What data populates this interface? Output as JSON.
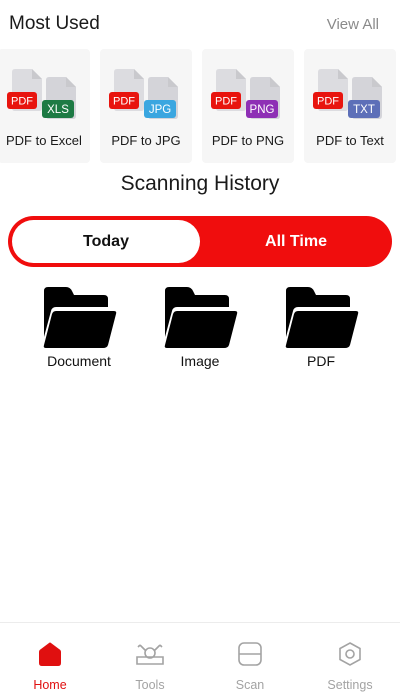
{
  "most_used": {
    "title": "Most Used",
    "view_all": "View All",
    "tools": [
      {
        "label": "PDF to Excel",
        "src_badge": "PDF",
        "dst_badge": "XLS",
        "dst_color": "#1d7a44"
      },
      {
        "label": "PDF to JPG",
        "src_badge": "PDF",
        "dst_badge": "JPG",
        "dst_color": "#3aa6e0"
      },
      {
        "label": "PDF to PNG",
        "src_badge": "PDF",
        "dst_badge": "PNG",
        "dst_color": "#8e2fb5"
      },
      {
        "label": "PDF to Text",
        "src_badge": "PDF",
        "dst_badge": "TXT",
        "dst_color": "#5d6fb8"
      }
    ]
  },
  "history": {
    "title": "Scanning History",
    "tabs": {
      "today": "Today",
      "all_time": "All Time",
      "selected": "today"
    },
    "folders": [
      {
        "label": "Document",
        "icon": "folder-open-icon"
      },
      {
        "label": "Image",
        "icon": "folder-open-icon"
      },
      {
        "label": "PDF",
        "icon": "folder-open-icon"
      }
    ]
  },
  "nav": {
    "items": [
      {
        "label": "Home",
        "icon": "home-icon",
        "active": true
      },
      {
        "label": "Tools",
        "icon": "tools-icon",
        "active": false
      },
      {
        "label": "Scan",
        "icon": "scan-icon",
        "active": false
      },
      {
        "label": "Settings",
        "icon": "settings-icon",
        "active": false
      }
    ]
  },
  "colors": {
    "accent": "#f00d0d",
    "pdf_badge": "#e8140e",
    "inactive": "#a3a3a3"
  }
}
